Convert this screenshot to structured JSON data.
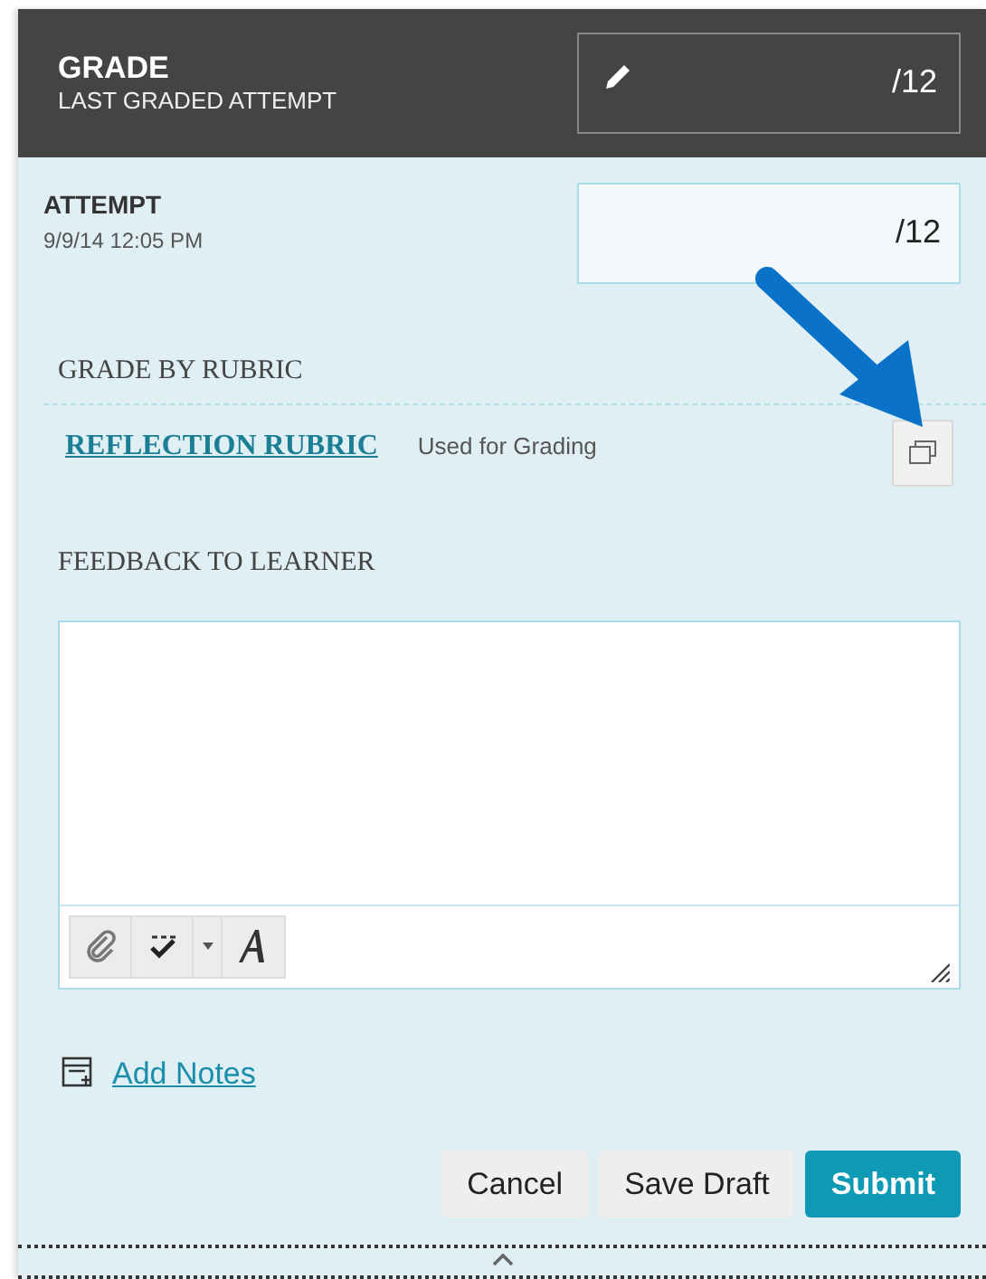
{
  "header": {
    "title": "GRADE",
    "subtitle": "LAST GRADED ATTEMPT",
    "grade_suffix": "/12"
  },
  "attempt": {
    "label": "ATTEMPT",
    "date": "9/9/14 12:05 PM",
    "score_suffix": "/12"
  },
  "rubric": {
    "heading": "GRADE BY RUBRIC",
    "link": "REFLECTION RUBRIC",
    "status": "Used for Grading"
  },
  "feedback": {
    "heading": "FEEDBACK TO LEARNER"
  },
  "notes": {
    "link": "Add Notes"
  },
  "buttons": [
    {
      "label": "Cancel",
      "kind": "secondary"
    },
    {
      "label": "Save Draft",
      "kind": "secondary"
    },
    {
      "label": "Submit",
      "kind": "primary"
    }
  ]
}
